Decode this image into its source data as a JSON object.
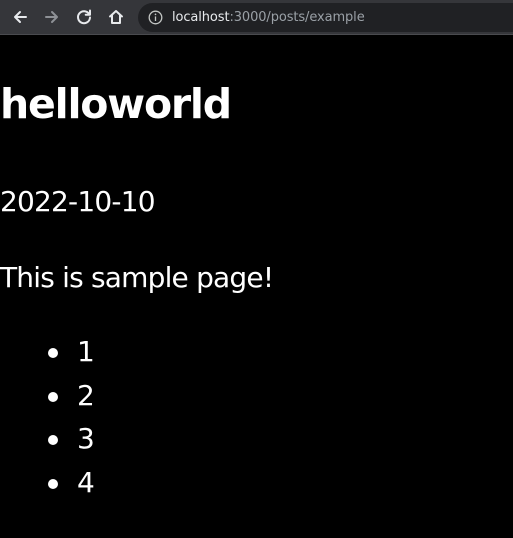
{
  "browser": {
    "url_host": "localhost",
    "url_rest": ":3000/posts/example",
    "toolbar_color": "#35363a",
    "omnibox_color": "#202124",
    "icons": {
      "back": "arrow-left-icon",
      "forward": "arrow-right-icon",
      "reload": "reload-icon",
      "home": "home-icon",
      "info": "info-icon"
    }
  },
  "page": {
    "background": "#000000",
    "text_color": "#ffffff",
    "title": "helloworld",
    "date": "2022-10-10",
    "body": "This is sample page!",
    "list_items": [
      "1",
      "2",
      "3",
      "4"
    ]
  }
}
